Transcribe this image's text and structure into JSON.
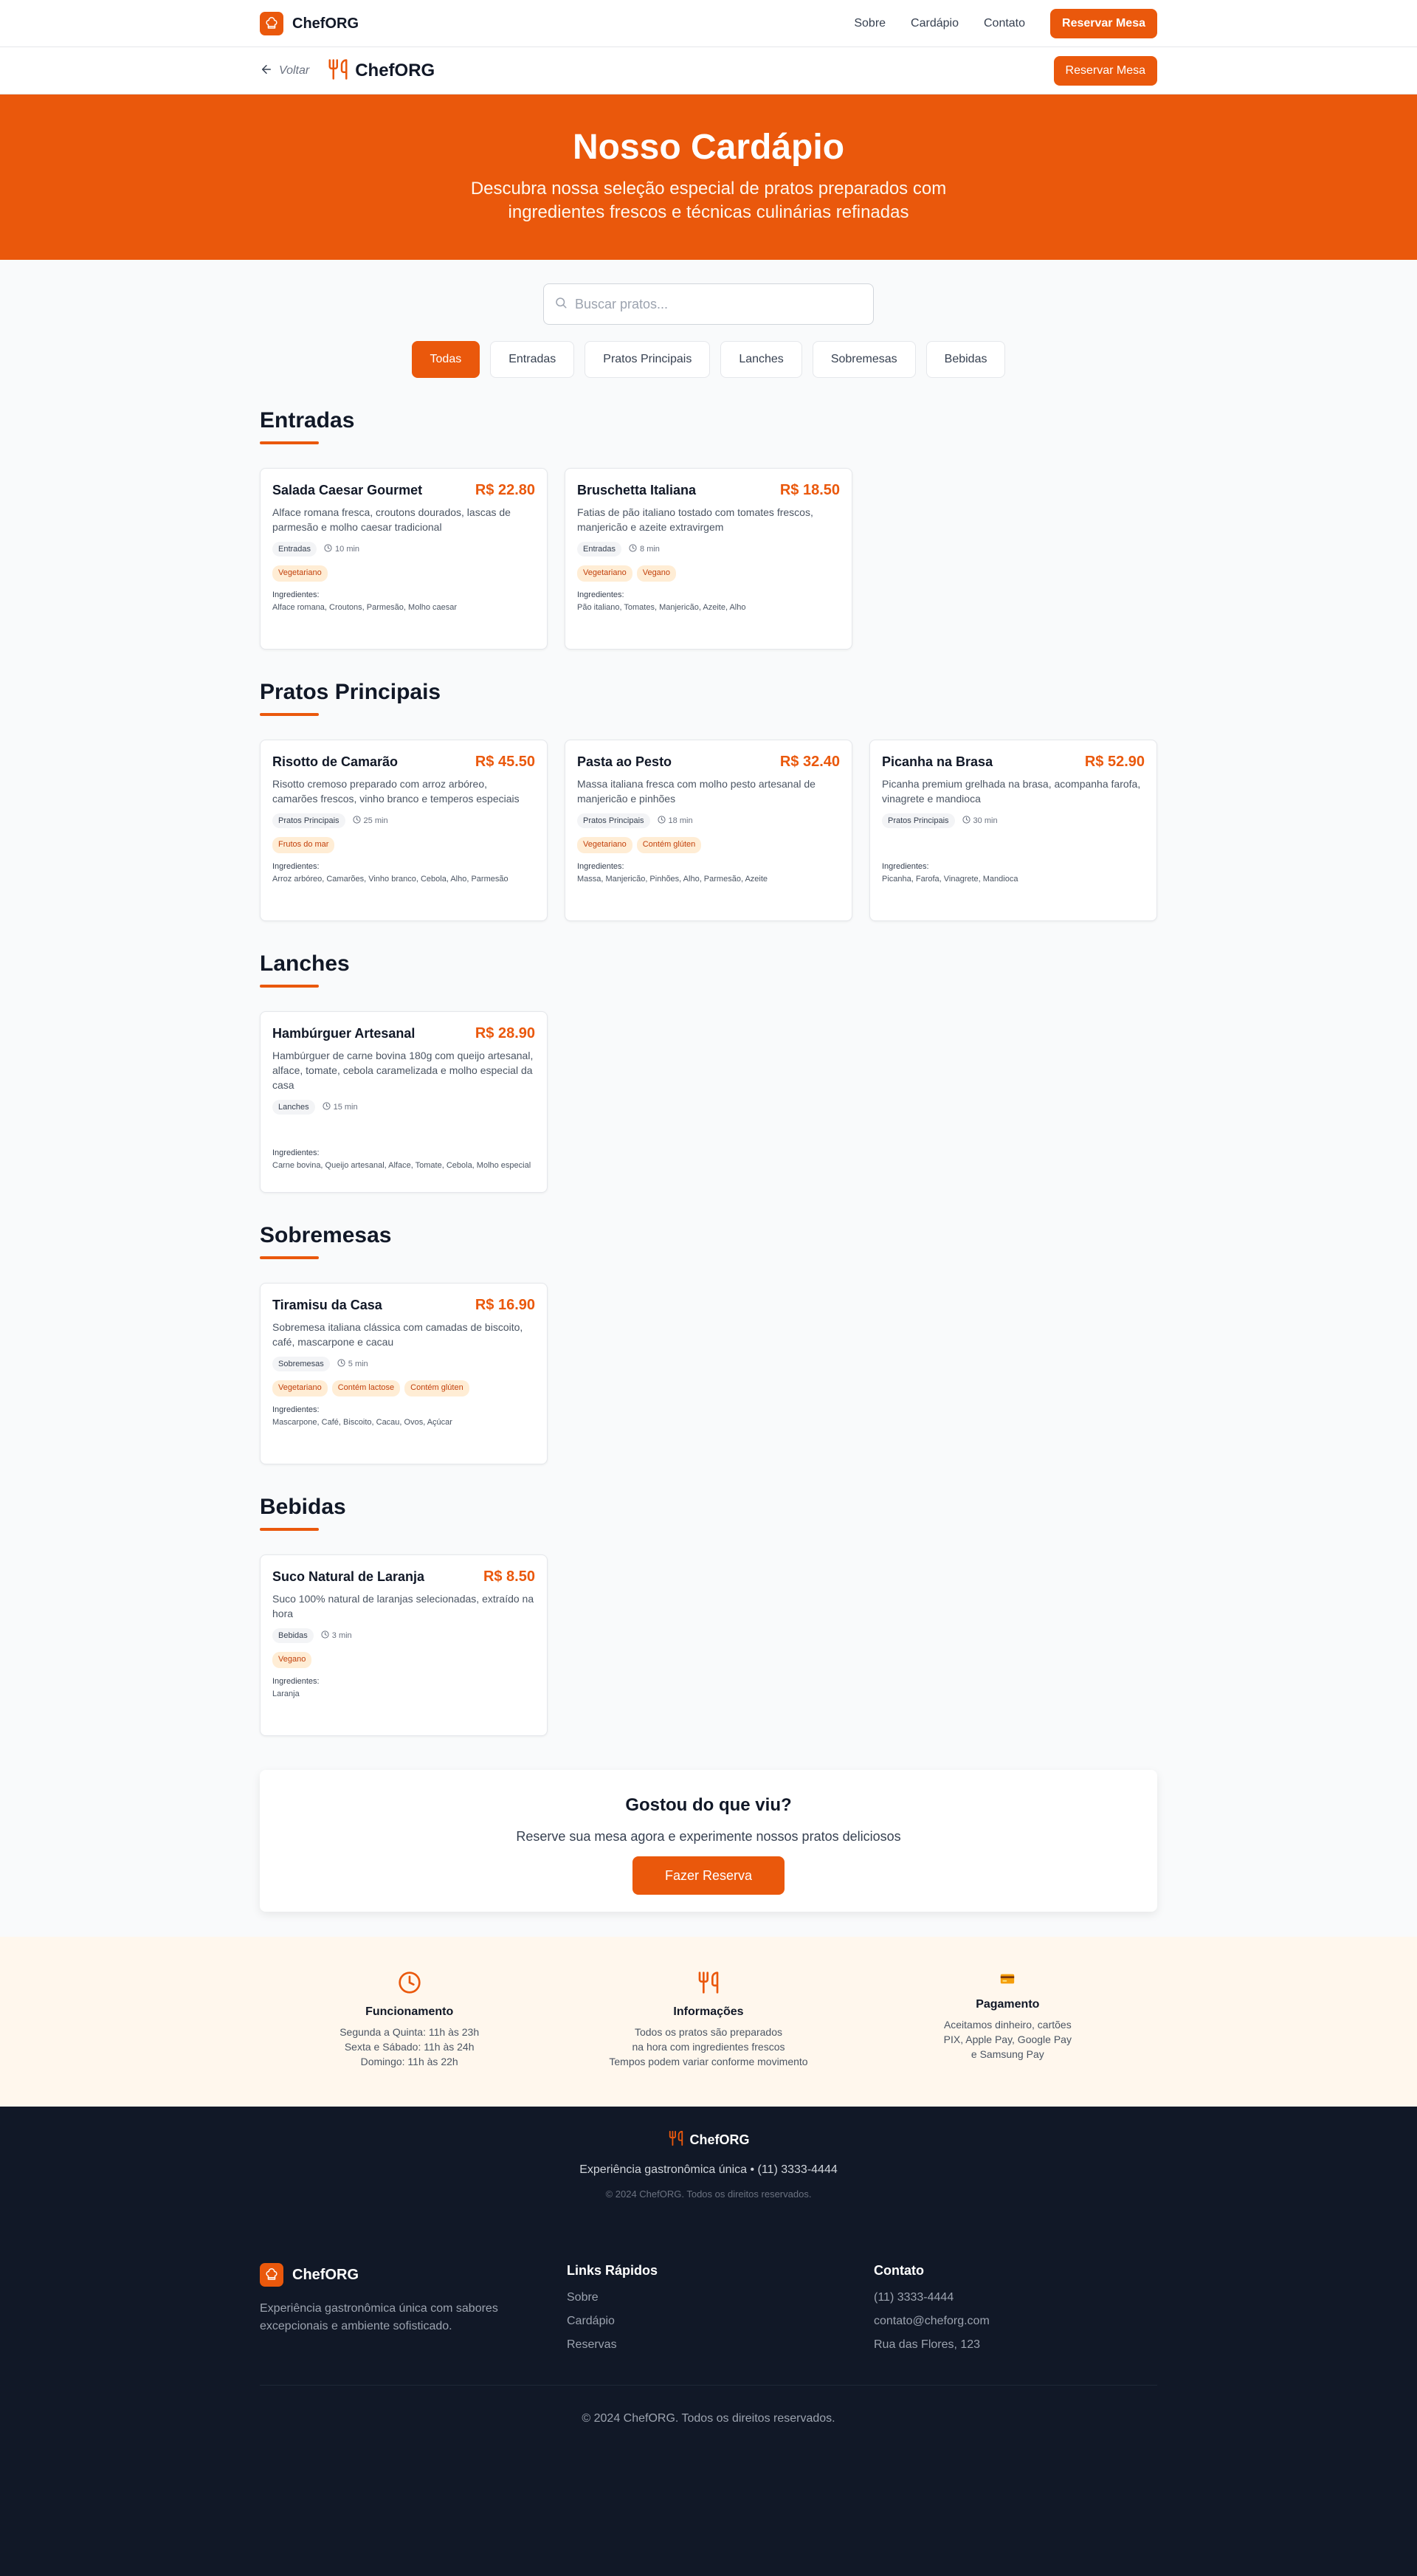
{
  "brand": {
    "name": "ChefORG"
  },
  "topnav": {
    "links": [
      "Sobre",
      "Cardápio",
      "Contato"
    ],
    "cta": "Reservar Mesa"
  },
  "subhead": {
    "back": "Voltar",
    "brand": "ChefORG",
    "cta": "Reservar Mesa"
  },
  "hero": {
    "title": "Nosso Cardápio",
    "subtitle": "Descubra nossa seleção especial de pratos preparados com ingredientes frescos e técnicas culinárias refinadas"
  },
  "search": {
    "placeholder": "Buscar pratos...",
    "value": ""
  },
  "filters": [
    "Todas",
    "Entradas",
    "Pratos Principais",
    "Lanches",
    "Sobremesas",
    "Bebidas"
  ],
  "labels": {
    "ingredients": "Ingredientes:"
  },
  "sections": [
    {
      "title": "Entradas",
      "dishes": [
        {
          "name": "Salada Caesar Gourmet",
          "price": "R$ 22.80",
          "desc": "Alface romana fresca, croutons dourados, lascas de parmesão e molho caesar tradicional",
          "category": "Entradas",
          "time": "10 min",
          "tags": [
            "Vegetariano"
          ],
          "ingredients": "Alface romana, Croutons, Parmesão, Molho caesar"
        },
        {
          "name": "Bruschetta Italiana",
          "price": "R$ 18.50",
          "desc": "Fatias de pão italiano tostado com tomates frescos, manjericão e azeite extravirgem",
          "category": "Entradas",
          "time": "8 min",
          "tags": [
            "Vegetariano",
            "Vegano"
          ],
          "ingredients": "Pão italiano, Tomates, Manjericão, Azeite, Alho"
        }
      ]
    },
    {
      "title": "Pratos Principais",
      "dishes": [
        {
          "name": "Risotto de Camarão",
          "price": "R$ 45.50",
          "desc": "Risotto cremoso preparado com arroz arbóreo, camarões frescos, vinho branco e temperos especiais",
          "category": "Pratos Principais",
          "time": "25 min",
          "tags": [
            "Frutos do mar"
          ],
          "ingredients": "Arroz arbóreo, Camarões, Vinho branco, Cebola, Alho, Parmesão"
        },
        {
          "name": "Pasta ao Pesto",
          "price": "R$ 32.40",
          "desc": "Massa italiana fresca com molho pesto artesanal de manjericão e pinhões",
          "category": "Pratos Principais",
          "time": "18 min",
          "tags": [
            "Vegetariano",
            "Contém glúten"
          ],
          "ingredients": "Massa, Manjericão, Pinhões, Alho, Parmesão, Azeite"
        },
        {
          "name": "Picanha na Brasa",
          "price": "R$ 52.90",
          "desc": "Picanha premium grelhada na brasa, acompanha farofa, vinagrete e mandioca",
          "category": "Pratos Principais",
          "time": "30 min",
          "tags": [],
          "ingredients": "Picanha, Farofa, Vinagrete, Mandioca"
        }
      ]
    },
    {
      "title": "Lanches",
      "dishes": [
        {
          "name": "Hambúrguer Artesanal",
          "price": "R$ 28.90",
          "desc": "Hambúrguer de carne bovina 180g com queijo artesanal, alface, tomate, cebola caramelizada e molho especial da casa",
          "category": "Lanches",
          "time": "15 min",
          "tags": [],
          "ingredients": "Carne bovina, Queijo artesanal, Alface, Tomate, Cebola, Molho especial"
        }
      ]
    },
    {
      "title": "Sobremesas",
      "dishes": [
        {
          "name": "Tiramisu da Casa",
          "price": "R$ 16.90",
          "desc": "Sobremesa italiana clássica com camadas de biscoito, café, mascarpone e cacau",
          "category": "Sobremesas",
          "time": "5 min",
          "tags": [
            "Vegetariano",
            "Contém lactose",
            "Contém glúten"
          ],
          "ingredients": "Mascarpone, Café, Biscoito, Cacau, Ovos, Açúcar"
        }
      ]
    },
    {
      "title": "Bebidas",
      "dishes": [
        {
          "name": "Suco Natural de Laranja",
          "price": "R$ 8.50",
          "desc": "Suco 100% natural de laranjas selecionadas, extraído na hora",
          "category": "Bebidas",
          "time": "3 min",
          "tags": [
            "Vegano"
          ],
          "ingredients": "Laranja"
        }
      ]
    }
  ],
  "cta": {
    "title": "Gostou do que viu?",
    "text": "Reserve sua mesa agora e experimente nossos pratos deliciosos",
    "button": "Fazer Reserva"
  },
  "info": [
    {
      "icon": "clock-icon",
      "title": "Funcionamento",
      "lines": [
        "Segunda a Quinta: 11h às 23h",
        "Sexta e Sábado: 11h às 24h",
        "Domingo: 11h às 22h"
      ]
    },
    {
      "icon": "utensils-icon",
      "title": "Informações",
      "lines": [
        "Todos os pratos são preparados",
        "na hora com ingredientes frescos",
        "Tempos podem variar conforme movimento"
      ]
    },
    {
      "icon": "credit-card-icon",
      "title": "Pagamento",
      "lines": [
        "Aceitamos dinheiro, cartões",
        "PIX, Apple Pay, Google Pay",
        "e Samsung Pay"
      ]
    }
  ],
  "footer_small": {
    "brand": "ChefORG",
    "tagline": "Experiência gastronômica única • (11) 3333-4444",
    "copyright": "© 2024 ChefORG. Todos os direitos reservados."
  },
  "footer": {
    "brand": "ChefORG",
    "about": "Experiência gastronômica única com sabores excepcionais e ambiente sofisticado.",
    "links_title": "Links Rápidos",
    "links": [
      "Sobre",
      "Cardápio",
      "Reservas"
    ],
    "contact_title": "Contato",
    "contact": [
      "(11) 3333-4444",
      "contato@cheforg.com",
      "Rua das Flores, 123"
    ],
    "copyright": "© 2024 ChefORG. Todos os direitos reservados."
  },
  "colors": {
    "accent": "#ea580c",
    "dark": "#111827",
    "cream": "#fff7ed"
  }
}
